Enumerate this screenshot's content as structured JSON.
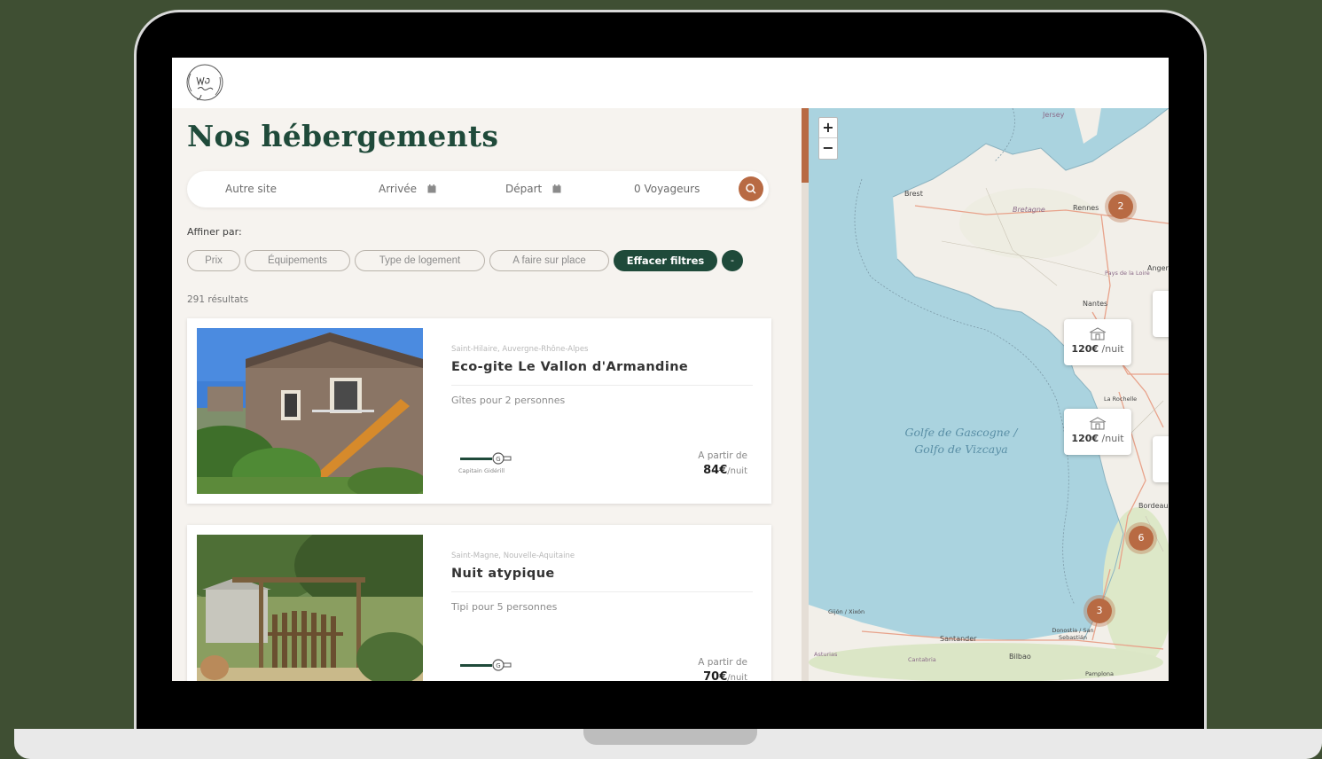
{
  "page": {
    "title": "Nos hébergements",
    "logo_text": "We go green"
  },
  "search": {
    "site_placeholder": "Autre site",
    "arrival_label": "Arrivée",
    "departure_label": "Départ",
    "travelers_label": "0 Voyageurs"
  },
  "filters": {
    "label": "Affiner par:",
    "chips": [
      "Prix",
      "Équipements",
      "Type de logement",
      "A faire sur place"
    ],
    "clear_label": "Effacer filtres",
    "toggle_label": "-"
  },
  "results": {
    "count_label": "291 résultats"
  },
  "listings": [
    {
      "location": "Saint-Hilaire, Auvergne-Rhône-Alpes",
      "title": "Eco-gite Le Vallon d'Armandine",
      "description": "Gîtes pour 2 personnes",
      "host": "Capitain Gidérill",
      "from_label": "A partir de",
      "price": "84€",
      "per_night": "/nuit"
    },
    {
      "location": "Saint-Magne, Nouvelle-Aquitaine",
      "title": "Nuit atypique",
      "description": "Tipi pour 5 personnes",
      "host": "",
      "from_label": "A partir de",
      "price": "70€",
      "per_night": "/nuit"
    }
  ],
  "map": {
    "zoom_in": "+",
    "zoom_out": "−",
    "clusters": [
      "2",
      "6",
      "3"
    ],
    "price_pins": [
      {
        "price": "120€",
        "per": "/nuit"
      },
      {
        "price": "120€",
        "per": "/nuit"
      }
    ],
    "places": [
      "Jersey",
      "Brest",
      "Bretagne",
      "Rennes",
      "Pays de la Loire",
      "Angers",
      "Nantes",
      "La Rochelle",
      "Bordeaux",
      "Donostia / San Sebastián",
      "Bilbao",
      "Santander",
      "Gijón / Xixón",
      "Asturias",
      "Cantabria",
      "Pamplona"
    ],
    "sea_line1": "Golfe de Gascogne /",
    "sea_line2": "Golfo de Vizcaya"
  },
  "colors": {
    "background": "#3f4f33",
    "brand_green": "#1f4a3a",
    "accent": "#b86a43",
    "sea": "#aad3df",
    "land": "#f2efe9"
  }
}
